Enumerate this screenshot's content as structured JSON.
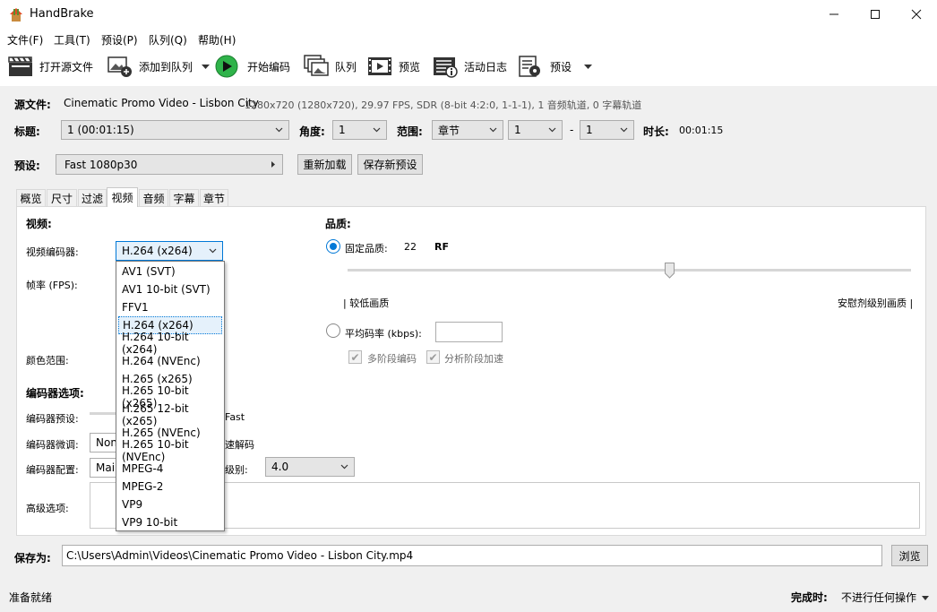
{
  "app": {
    "title": "HandBrake"
  },
  "menu": [
    "文件(F)",
    "工具(T)",
    "预设(P)",
    "队列(Q)",
    "帮助(H)"
  ],
  "toolbar": {
    "open_source": "打开源文件",
    "add_to_queue": "添加到队列",
    "start_encode": "开始编码",
    "queue": "队列",
    "preview": "预览",
    "activity_log": "活动日志",
    "presets": "预设"
  },
  "source": {
    "label": "源文件:",
    "name": "Cinematic Promo Video - Lisbon City",
    "info": "1280x720 (1280x720), 29.97 FPS, SDR (8-bit 4:2:0, 1-1-1), 1 音频轨道, 0 字幕轨道"
  },
  "title_row": {
    "title_label": "标题:",
    "title_value": "1  (00:01:15)",
    "angle_label": "角度:",
    "angle_value": "1",
    "range_label": "范围:",
    "range_type": "章节",
    "range_start": "1",
    "range_dash": "-",
    "range_end": "1",
    "duration_label": "时长:",
    "duration_value": "00:01:15"
  },
  "preset_row": {
    "label": "预设:",
    "value": "Fast 1080p30",
    "reload": "重新加载",
    "save_new": "保存新预设"
  },
  "tabs": [
    "概览",
    "尺寸",
    "过滤",
    "视频",
    "音频",
    "字幕",
    "章节"
  ],
  "active_tab": "视频",
  "video": {
    "section_title": "视频:",
    "encoder_label": "视频编码器:",
    "encoder_value": "H.264 (x264)",
    "fps_label": "帧率 (FPS):",
    "color_range_label": "颜色范围:",
    "encoder_options_title": "编码器选项:",
    "encoder_preset_label": "编码器预设:",
    "encoder_preset_value": "Fast",
    "encoder_tune_label": "编码器微调:",
    "encoder_tune_value": "Non",
    "fast_decode": "速解码",
    "encoder_profile_label": "编码器配置:",
    "encoder_profile_value": "Main",
    "level_label": "级别:",
    "level_value": "4.0",
    "advanced_label": "高级选项:"
  },
  "quality": {
    "title": "品质:",
    "cq_label": "固定品质:",
    "cq_value": "22",
    "cq_unit": "RF",
    "slider_level_fraction": 0.57,
    "low_label": "| 较低画质",
    "high_label": "安慰剂级别画质 |",
    "avg_bitrate_label": "平均码率 (kbps):",
    "avg_bitrate_value": "",
    "multipass": "多阶段编码",
    "turbo": "分析阶段加速"
  },
  "encoder_dropdown": {
    "options": [
      "AV1 (SVT)",
      "AV1 10-bit (SVT)",
      "FFV1",
      "H.264 (x264)",
      "H.264 10-bit (x264)",
      "H.264 (NVEnc)",
      "H.265 (x265)",
      "H.265 10-bit (x265)",
      "H.265 12-bit (x265)",
      "H.265 (NVEnc)",
      "H.265 10-bit (NVEnc)",
      "MPEG-4",
      "MPEG-2",
      "VP9",
      "VP9 10-bit"
    ],
    "selected": "H.264 (x264)"
  },
  "save": {
    "label": "保存为:",
    "path": "C:\\Users\\Admin\\Videos\\Cinematic Promo Video - Lisbon City.mp4",
    "browse": "浏览"
  },
  "status": {
    "text": "准备就绪",
    "when_done_label": "完成时:",
    "when_done_value": "不进行任何操作"
  },
  "colors": {
    "accent": "#0078d7",
    "play_green": "#2fb34a"
  }
}
